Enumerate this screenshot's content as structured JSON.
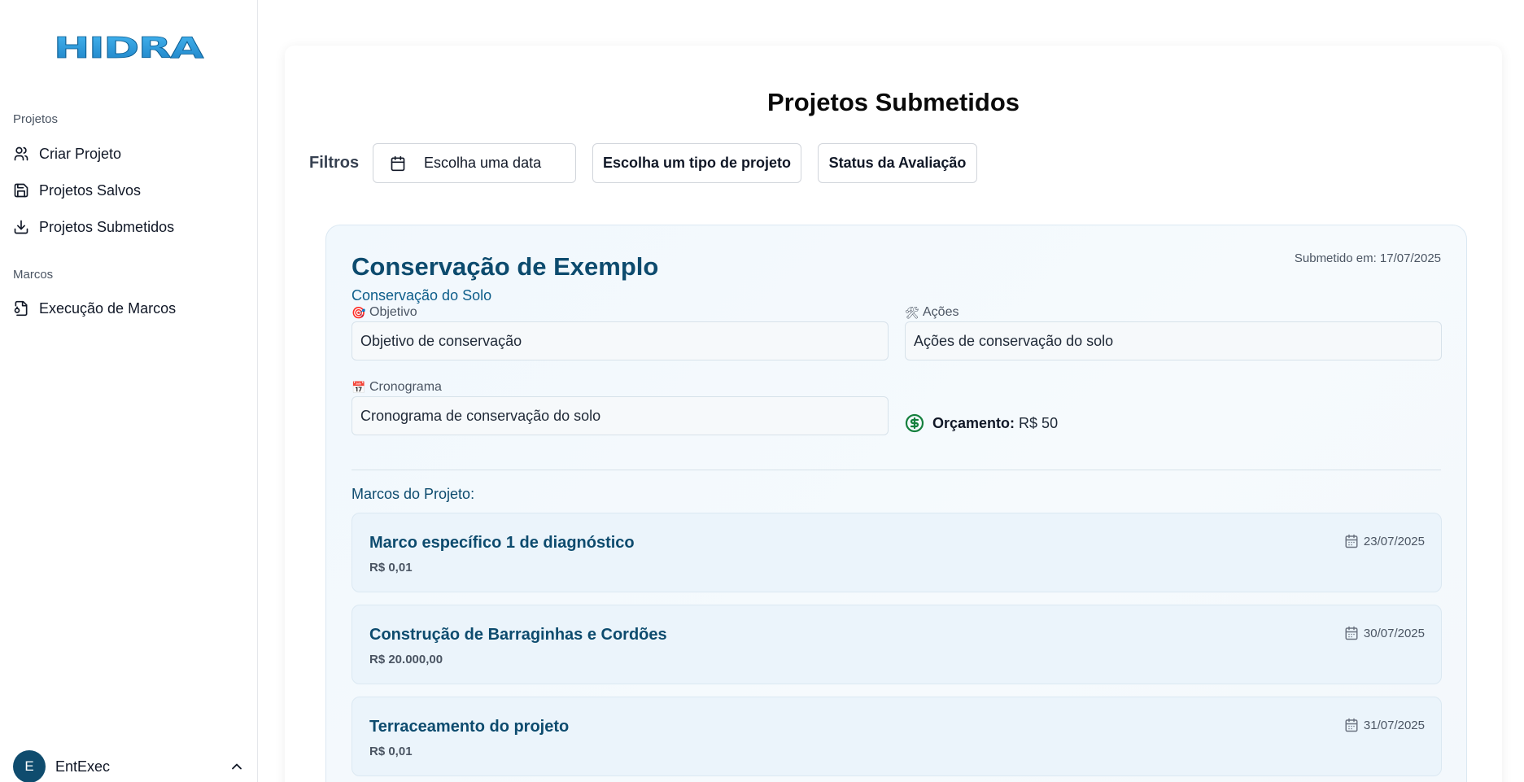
{
  "brand": {
    "logo_text": "HIDRA"
  },
  "sidebar": {
    "groups": [
      {
        "label": "Projetos",
        "items": [
          {
            "label": "Criar Projeto",
            "icon": "users-icon"
          },
          {
            "label": "Projetos Salvos",
            "icon": "save-icon"
          },
          {
            "label": "Projetos Submetidos",
            "icon": "download-icon"
          }
        ]
      },
      {
        "label": "Marcos",
        "items": [
          {
            "label": "Execução de Marcos",
            "icon": "file-sync-icon"
          }
        ]
      }
    ],
    "user": {
      "initial": "E",
      "name": "EntExec"
    }
  },
  "main": {
    "title": "Projetos Submetidos",
    "filters": {
      "label": "Filtros",
      "date_placeholder": "Escolha uma data",
      "type_label": "Escolha um tipo de projeto",
      "status_label": "Status da Avaliação"
    },
    "project": {
      "title": "Conservação de Exemplo",
      "subtitle": "Conservação do Solo",
      "submitted": "Submetido em: 17/07/2025",
      "objetivo_label": "Objetivo",
      "objetivo_value": "Objetivo de conservação",
      "acoes_label": "Ações",
      "acoes_value": "Ações de conservação do solo",
      "cronograma_label": "Cronograma",
      "cronograma_value": "Cronograma de conservação do solo",
      "budget_label": "Orçamento:",
      "budget_value": "R$ 50",
      "marcos_title": "Marcos do Projeto:",
      "marcos": [
        {
          "name": "Marco específico 1 de diagnóstico",
          "value": "R$ 0,01",
          "date": "23/07/2025"
        },
        {
          "name": "Construção de Barraginhas e Cordões",
          "value": "R$ 20.000,00",
          "date": "30/07/2025"
        },
        {
          "name": "Terraceamento do projeto",
          "value": "R$ 0,01",
          "date": "31/07/2025"
        }
      ]
    }
  },
  "colors": {
    "primary": "#0d4b6e",
    "accent": "#0d5d8a",
    "money": "#15803d",
    "logo_blue": "#29a3e6"
  }
}
